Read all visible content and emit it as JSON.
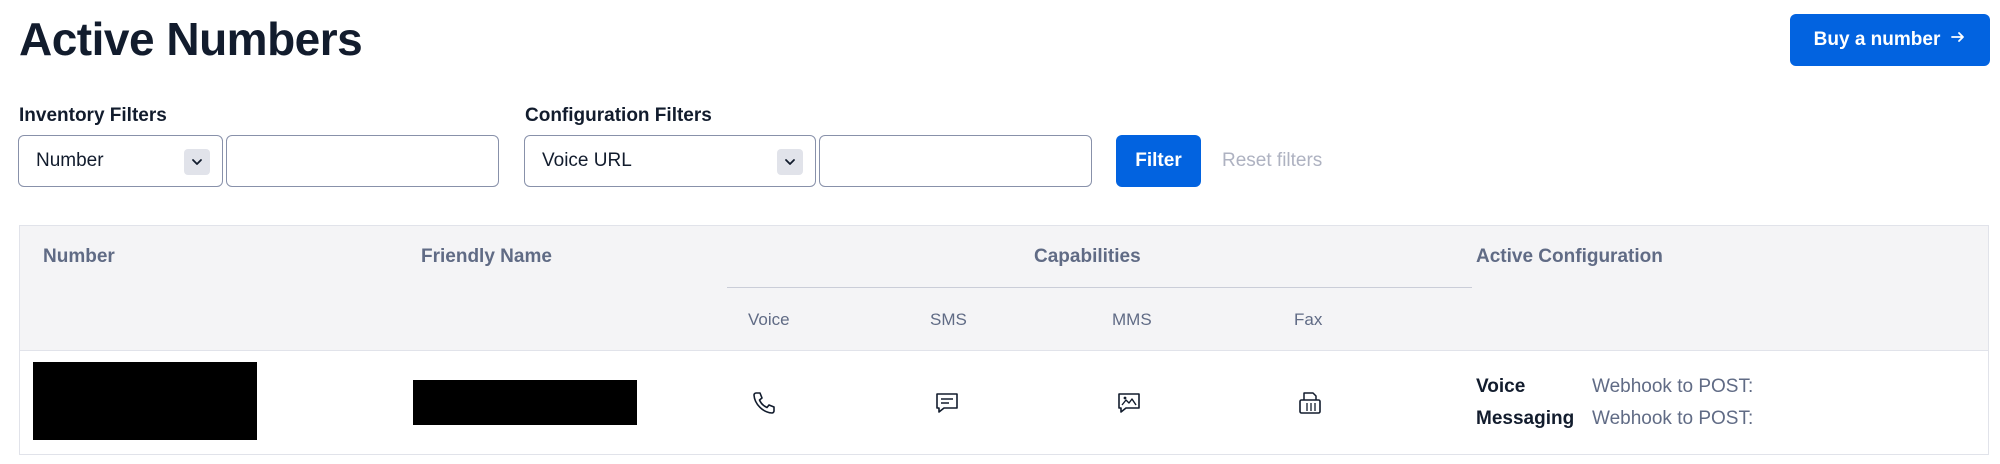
{
  "page": {
    "title": "Active Numbers",
    "buy_button": "Buy a number"
  },
  "filters": {
    "inventory": {
      "label": "Inventory Filters",
      "selected": "Number",
      "value": ""
    },
    "configuration": {
      "label": "Configuration Filters",
      "selected": "Voice URL",
      "value": ""
    },
    "filter_button": "Filter",
    "reset_link": "Reset filters"
  },
  "table": {
    "headers": {
      "number": "Number",
      "friendly_name": "Friendly Name",
      "capabilities": "Capabilities",
      "active_configuration": "Active Configuration"
    },
    "capability_columns": [
      "Voice",
      "SMS",
      "MMS",
      "Fax"
    ],
    "rows": [
      {
        "capability_icons": [
          "phone-icon",
          "sms-icon",
          "mms-icon",
          "fax-icon"
        ],
        "configuration": [
          {
            "label": "Voice",
            "value": "Webhook to POST:"
          },
          {
            "label": "Messaging",
            "value": "Webhook to POST:"
          }
        ]
      }
    ]
  },
  "colors": {
    "primary": "#0263e0",
    "text": "#121c2d",
    "muted": "#606b85",
    "header_bg": "#f4f4f6",
    "disabled": "#aeb2c1"
  }
}
